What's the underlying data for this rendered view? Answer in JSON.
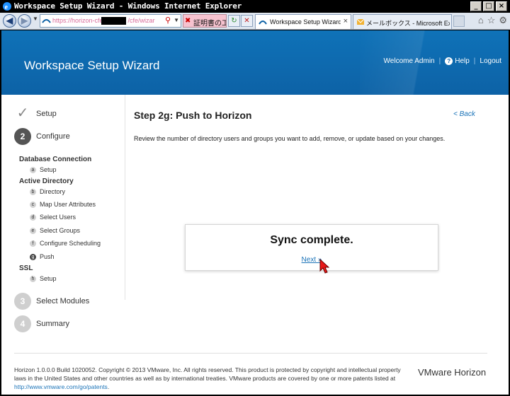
{
  "window": {
    "title": "Workspace Setup Wizard - Windows Internet Explorer",
    "controls": {
      "minimize": "_",
      "maximize": "□",
      "close": "×"
    }
  },
  "browser": {
    "address_url": "https://horizon-cfe",
    "address_url_tail": "/cfe/wizard/pus",
    "tab_japanese": "証明書の工...",
    "tabs": [
      {
        "label": "Workspace Setup Wizard",
        "active": true,
        "icon": "workspace-icon"
      },
      {
        "label": "メールボックス - Microsoft Exch...",
        "active": false,
        "icon": "outlook-icon"
      }
    ],
    "tools": [
      "home-icon",
      "star-icon",
      "gear-icon"
    ]
  },
  "header": {
    "title": "Workspace Setup Wizard",
    "welcome": "Welcome Admin",
    "help": "Help",
    "logout": "Logout"
  },
  "sidebar": {
    "steps": [
      {
        "marker": "✓",
        "label": "Setup",
        "state": "done"
      },
      {
        "marker": "2",
        "label": "Configure",
        "state": "current"
      },
      {
        "marker": "3",
        "label": "Select Modules",
        "state": "pending"
      },
      {
        "marker": "4",
        "label": "Summary",
        "state": "pending"
      }
    ],
    "groups": {
      "database": {
        "title": "Database Connection",
        "items": [
          {
            "letter": "a",
            "label": "Setup"
          }
        ]
      },
      "directory": {
        "title": "Active Directory",
        "items": [
          {
            "letter": "b",
            "label": "Directory"
          },
          {
            "letter": "c",
            "label": "Map User Attributes"
          },
          {
            "letter": "d",
            "label": "Select Users"
          },
          {
            "letter": "e",
            "label": "Select Groups"
          },
          {
            "letter": "f",
            "label": "Configure Scheduling"
          },
          {
            "letter": "g",
            "label": "Push",
            "active": true
          }
        ]
      },
      "ssl": {
        "title": "SSL",
        "items": [
          {
            "letter": "h",
            "label": "Setup"
          }
        ]
      }
    }
  },
  "main": {
    "heading": "Step 2g: Push to Horizon",
    "back": "< Back",
    "description": "Review the number of directory users and groups you want to add, remove, or update based on your changes.",
    "sync_status": "Sync complete.",
    "next": "Next »"
  },
  "footer": {
    "text": "Horizon 1.0.0.0 Build 1020052. Copyright © 2013 VMware, Inc. All rights reserved. This product is protected by copyright and intellectual property laws in the United States and other countries as well as by international treaties. VMware products are covered by one or more patents listed at ",
    "patent_link": "http://www.vmware.com/go/patents",
    "text_end": ".",
    "brand": "VMware Horizon"
  },
  "colors": {
    "banner": "#0d62a6",
    "link": "#1a73b8",
    "step_current": "#555555",
    "step_pending": "#cfcfcf"
  }
}
